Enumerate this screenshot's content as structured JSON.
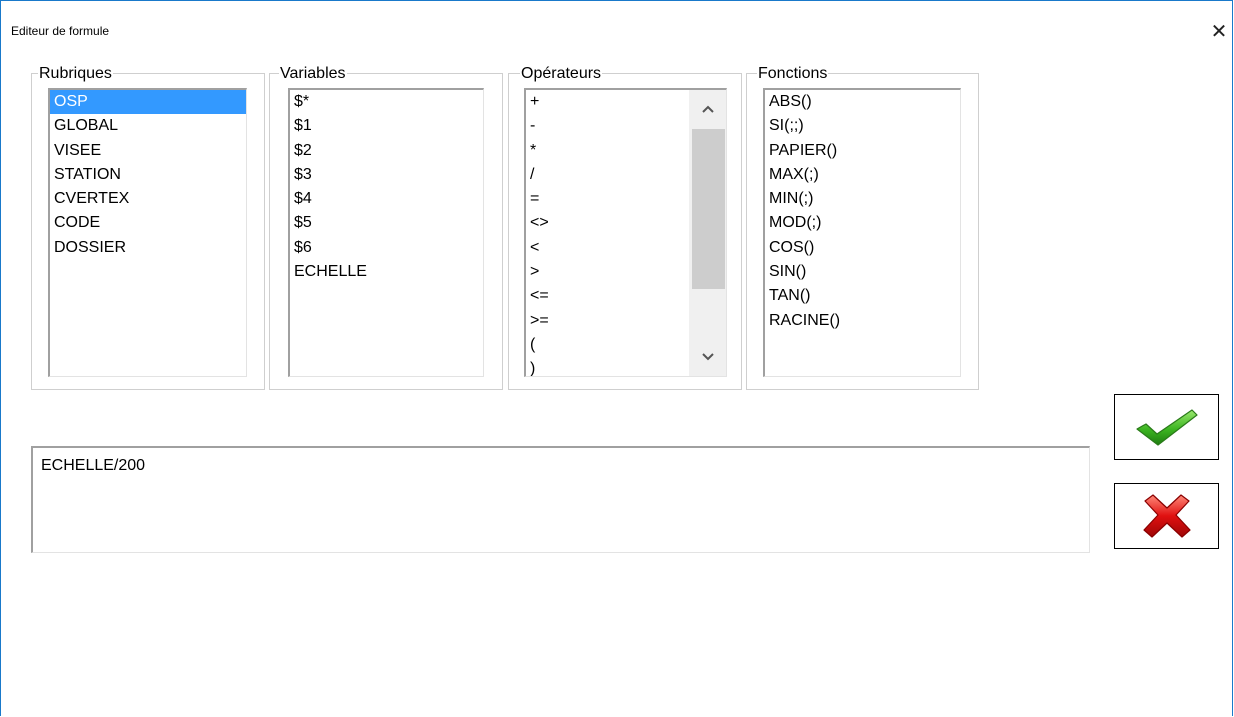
{
  "window": {
    "title": "Editeur de formule",
    "close_glyph": "✕"
  },
  "groups": {
    "rubriques": {
      "legend": "Rubriques",
      "items": [
        "OSP",
        "GLOBAL",
        "VISEE",
        "STATION",
        "CVERTEX",
        "CODE",
        "DOSSIER"
      ],
      "selected": "OSP"
    },
    "variables": {
      "legend": "Variables",
      "items": [
        "$*",
        "$1",
        "$2",
        "$3",
        "$4",
        "$5",
        "$6",
        "ECHELLE"
      ]
    },
    "operateurs": {
      "legend": "Opérateurs",
      "items": [
        "+",
        "-",
        "*",
        "/",
        "=",
        "<>",
        "<",
        ">",
        "<=",
        ">=",
        "(",
        ")"
      ]
    },
    "fonctions": {
      "legend": "Fonctions",
      "items": [
        "ABS()",
        "SI(;;)",
        "PAPIER()",
        "MAX(;)",
        "MIN(;)",
        "MOD(;)",
        "COS()",
        "SIN()",
        "TAN()",
        "RACINE()"
      ]
    }
  },
  "formula": {
    "value": "ECHELLE/200"
  },
  "buttons": {
    "ok_icon": "checkmark-icon",
    "cancel_icon": "red-x-icon"
  },
  "colors": {
    "selection": "#3399ff",
    "window_border": "#1979ca",
    "ok_green": "#3cb521",
    "cancel_red": "#e01010"
  }
}
